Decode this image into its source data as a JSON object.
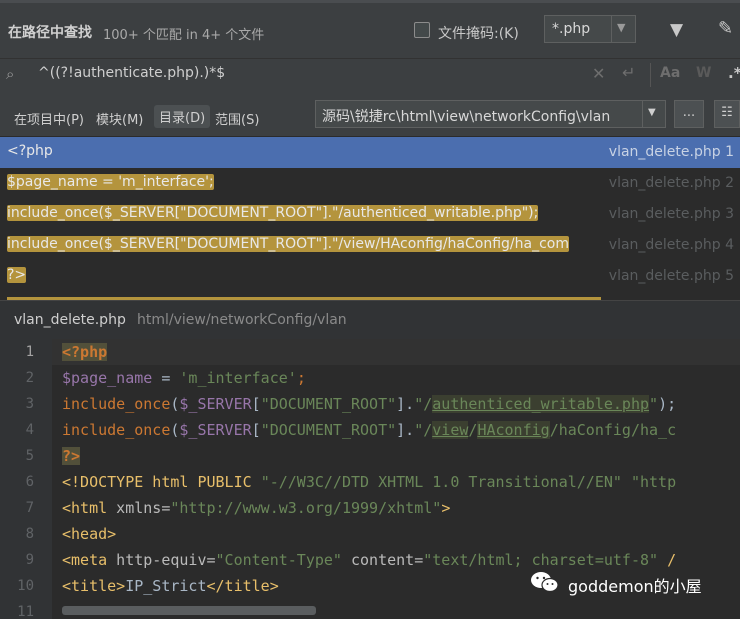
{
  "header": {
    "title": "在路径中查找",
    "subtitle": "100+ 个匹配 in 4+ 个文件",
    "file_mask_label": "文件掩码:(K)",
    "file_mask_value": "*.php",
    "file_mask_checked": false
  },
  "search": {
    "query": "^((?!authenticate.php).)*$",
    "match_case_label": "Aa",
    "words_label": "W",
    "regex_label": ".*"
  },
  "scope": {
    "tabs": [
      "在项目中(P)",
      "模块(M)",
      "目录(D)",
      "范围(S)"
    ],
    "selected_tab": "目录(D)",
    "directory": "源码\\锐捷rc\\html\\view\\networkConfig\\vlan",
    "more_label": "..."
  },
  "results": [
    {
      "code": "<?php",
      "file": "vlan_delete.php",
      "line": "1",
      "selected": true
    },
    {
      "code": "$page_name = 'm_interface';",
      "file": "vlan_delete.php",
      "line": "2",
      "selected": false
    },
    {
      "code": "include_once($_SERVER[\"DOCUMENT_ROOT\"].\"/authenticed_writable.php\");",
      "file": "vlan_delete.php",
      "line": "3",
      "selected": false
    },
    {
      "code": "include_once($_SERVER[\"DOCUMENT_ROOT\"].\"/view/HAconfig/haConfig/ha_com",
      "file": "vlan_delete.php",
      "line": "4",
      "selected": false
    },
    {
      "code": "?>",
      "file": "vlan_delete.php",
      "line": "5",
      "selected": false
    }
  ],
  "preview": {
    "file_name": "vlan_delete.php",
    "file_path": "html/view/networkConfig/vlan",
    "line_numbers": [
      "1",
      "2",
      "3",
      "4",
      "5",
      "6",
      "7",
      "8",
      "9",
      "10",
      "11"
    ]
  },
  "code": {
    "l1": "<?php",
    "l2_var": "$page_name",
    "l2_eq": " = ",
    "l2_str": "'m_interface'",
    "l2_end": ";",
    "l3_fn": "include_once",
    "l3_a": "(",
    "l3_var": "$_SERVER",
    "l3_b": "[",
    "l3_str1": "\"DOCUMENT_ROOT\"",
    "l3_c": "].",
    "l3_str2a": "\"/",
    "l3_str2u": "authenticed_writable.php",
    "l3_str2b": "\"",
    "l3_end": ");",
    "l4_fn": "include_once",
    "l4_a": "(",
    "l4_var": "$_SERVER",
    "l4_b": "[",
    "l4_str1": "\"DOCUMENT_ROOT\"",
    "l4_c": "].",
    "l4_str2a": "\"/",
    "l4_u1": "view",
    "l4_s": "/",
    "l4_u2": "HAconfig",
    "l4_rest": "/haConfig/ha_c",
    "l5": "?>",
    "l6_a": "<!DOCTYPE html PUBLIC ",
    "l6_s1": "\"-//W3C//DTD XHTML 1.0 Transitional//EN\"",
    "l6_s2": " \"http",
    "l7_t": "<html",
    "l7_attr": " xmlns=",
    "l7_val": "\"http://www.w3.org/1999/xhtml\"",
    "l7_end": ">",
    "l8": "<head>",
    "l9_t": "<meta",
    "l9_a1": " http-equiv=",
    "l9_v1": "\"Content-Type\"",
    "l9_a2": " content=",
    "l9_v2": "\"text/html; charset=utf-8\"",
    "l9_end": " /",
    "l10_t1": "<title>",
    "l10_txt": "IP_Strict",
    "l10_t2": "</title>"
  },
  "watermark": {
    "text": "goddemon的小屋"
  },
  "colors": {
    "selection": "#4b6eaf",
    "match_highlight": "#b4943d",
    "panel": "#3c3f41",
    "editor": "#2b2b2b"
  }
}
